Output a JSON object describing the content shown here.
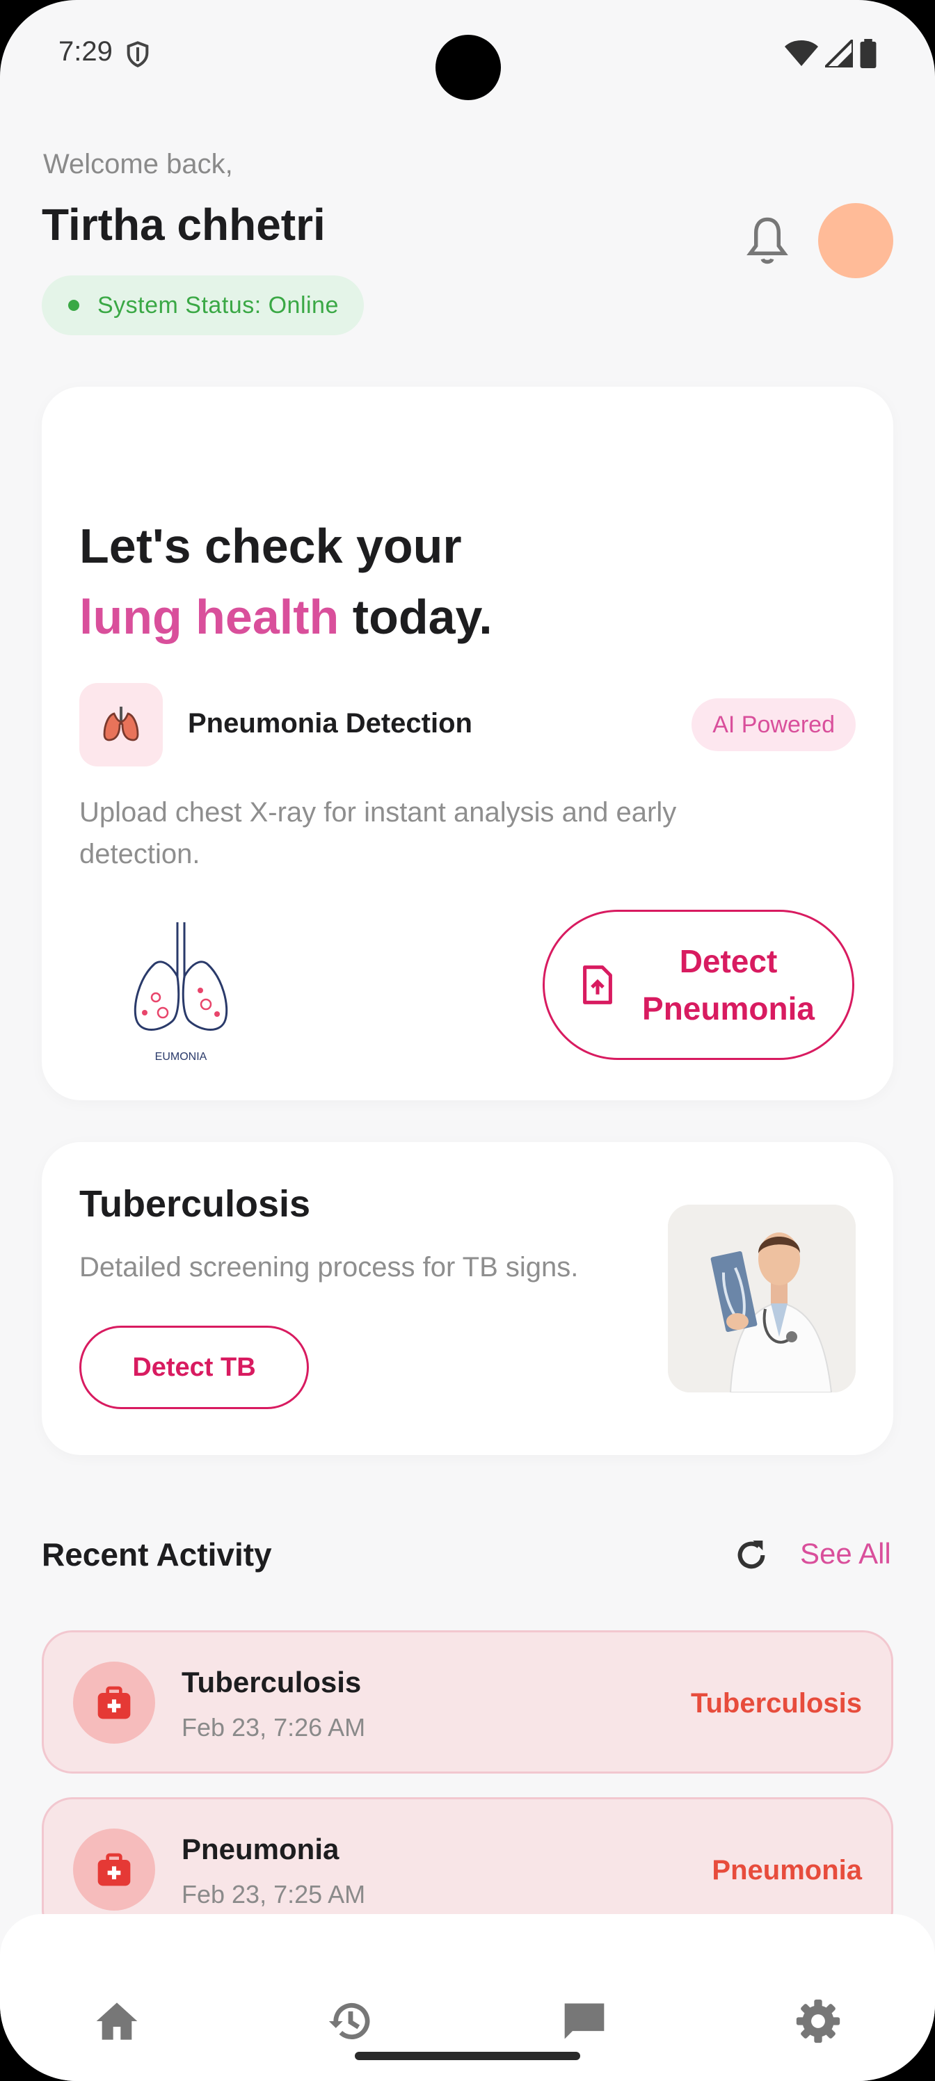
{
  "status_bar": {
    "time": "7:29"
  },
  "header": {
    "welcome": "Welcome back,",
    "username": "Tirtha chhetri",
    "system_status": "System Status: Online"
  },
  "hero": {
    "title_line1": "Let's check your",
    "title_highlight": "lung health",
    "title_rest": " today.",
    "feature_name": "Pneumonia Detection",
    "badge": "AI Powered",
    "description": "Upload chest X-ray for instant analysis and early detection.",
    "illustration_caption": "EUMONIA",
    "button_label": "Detect Pneumonia"
  },
  "tb_card": {
    "title": "Tuberculosis",
    "description": "Detailed screening process for TB signs.",
    "button_label": "Detect TB"
  },
  "recent": {
    "title": "Recent Activity",
    "see_all": "See All",
    "items": [
      {
        "name": "Tuberculosis",
        "time": "Feb 23, 7:26 AM",
        "result": "Tuberculosis"
      },
      {
        "name": "Pneumonia",
        "time": "Feb 23, 7:25 AM",
        "result": "Pneumonia"
      }
    ]
  },
  "nav": {
    "items": [
      "home-icon",
      "history-icon",
      "chat-icon",
      "settings-icon"
    ]
  },
  "colors": {
    "accent_pink": "#d81b60",
    "highlight_pink": "#d94f9b",
    "status_green": "#3aa845",
    "result_red": "#e74c3c"
  }
}
